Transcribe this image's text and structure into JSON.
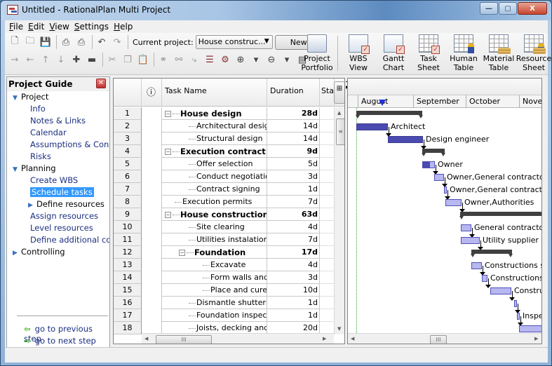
{
  "window": {
    "title": "Untitled - RationalPlan Multi Project",
    "controls": {
      "minimize": "—",
      "maximize": "▢",
      "close": "X"
    }
  },
  "menu": [
    {
      "label": "File",
      "mnemonic": "F",
      "rest": "ile"
    },
    {
      "label": "Edit",
      "mnemonic": "E",
      "rest": "dit"
    },
    {
      "label": "View",
      "mnemonic": "V",
      "rest": "iew"
    },
    {
      "label": "Settings",
      "mnemonic": "S",
      "rest": "ettings"
    },
    {
      "label": "Help",
      "mnemonic": "H",
      "rest": "elp"
    }
  ],
  "toolbar": {
    "row1_icons": [
      {
        "name": "new-file-icon",
        "glyph": "🗋"
      },
      {
        "name": "open-folder-icon",
        "glyph": "🗀"
      },
      {
        "name": "save-icon",
        "glyph": "💾"
      },
      {
        "name": "print-icon",
        "glyph": "⎙"
      },
      {
        "name": "print-preview-icon",
        "glyph": "⎙"
      },
      {
        "name": "undo-icon",
        "glyph": "↶"
      },
      {
        "name": "redo-icon",
        "glyph": "↷"
      }
    ],
    "current_project_label": "Current project:",
    "current_project_value": "House construc...",
    "new_button": "New",
    "row2_icons": [
      {
        "name": "indent-icon",
        "glyph": "→"
      },
      {
        "name": "outdent-icon",
        "glyph": "←"
      },
      {
        "name": "move-up-icon",
        "glyph": "↑"
      },
      {
        "name": "move-down-icon",
        "glyph": "↓"
      },
      {
        "name": "add-task-icon",
        "glyph": "✚"
      },
      {
        "name": "remove-task-icon",
        "glyph": "▬"
      },
      {
        "name": "cut-icon",
        "glyph": "✂"
      },
      {
        "name": "copy-icon",
        "glyph": "❐"
      },
      {
        "name": "paste-icon",
        "glyph": "📋"
      },
      {
        "name": "link-tasks-icon",
        "glyph": "⚭"
      },
      {
        "name": "unlink-tasks-icon",
        "glyph": "⚯"
      },
      {
        "name": "split-task-icon",
        "glyph": "⤷"
      },
      {
        "name": "gantt-bars-icon",
        "glyph": "☰"
      },
      {
        "name": "resource-assign-icon",
        "glyph": "⚙"
      },
      {
        "name": "zoom-in-icon",
        "glyph": "⊕"
      },
      {
        "name": "zoom-out-icon",
        "glyph": "⊖"
      },
      {
        "name": "notes-icon",
        "glyph": "▤"
      }
    ],
    "big_buttons": [
      {
        "name": "project-portfolio",
        "line1": "Project",
        "line2": "Portfolio"
      },
      {
        "name": "wbs-view",
        "line1": "WBS",
        "line2": "View"
      },
      {
        "name": "gantt-chart",
        "line1": "Gantt",
        "line2": "Chart"
      },
      {
        "name": "task-sheet",
        "line1": "Task",
        "line2": "Sheet"
      },
      {
        "name": "human-table",
        "line1": "Human",
        "line2": "Table"
      },
      {
        "name": "material-table",
        "line1": "Material",
        "line2": "Table"
      },
      {
        "name": "resource-sheet",
        "line1": "Resource",
        "line2": "Sheet"
      }
    ]
  },
  "guide": {
    "title": "Project Guide",
    "sections": [
      {
        "label": "Project",
        "expanded": true,
        "items": [
          "Info",
          "Notes & Links",
          "Calendar",
          "Assumptions & Constraints",
          "Risks"
        ]
      },
      {
        "label": "Planning",
        "expanded": true,
        "items": [
          "Create WBS",
          "Schedule tasks",
          "Define resources",
          "Assign resources",
          "Level resources",
          "Define additional costs"
        ]
      },
      {
        "label": "Controlling",
        "expanded": false,
        "items": []
      }
    ],
    "selected_item": "Schedule tasks",
    "prev_step": "go to previous step",
    "next_step": "go to next step"
  },
  "grid": {
    "columns": {
      "info": "ⓘ",
      "name": "Task Name",
      "duration": "Duration",
      "start": "Sta"
    },
    "rows": [
      {
        "id": "1",
        "name": "House design",
        "duration": "28d",
        "level": 0,
        "summary": true
      },
      {
        "id": "2",
        "name": "Architectural design",
        "duration": "14d",
        "level": 1,
        "summary": false
      },
      {
        "id": "3",
        "name": "Structural design",
        "duration": "14d",
        "level": 1,
        "summary": false
      },
      {
        "id": "4",
        "name": "Execution contract",
        "duration": "9d",
        "level": 0,
        "summary": true
      },
      {
        "id": "5",
        "name": "Offer selection",
        "duration": "5d",
        "level": 1,
        "summary": false
      },
      {
        "id": "6",
        "name": "Conduct negotiations",
        "duration": "3d",
        "level": 1,
        "summary": false
      },
      {
        "id": "7",
        "name": "Contract signing",
        "duration": "1d",
        "level": 1,
        "summary": false
      },
      {
        "id": "8",
        "name": "Execution permits",
        "duration": "7d",
        "level": 0,
        "summary": false
      },
      {
        "id": "9",
        "name": "House construction",
        "duration": "63d",
        "level": 0,
        "summary": true
      },
      {
        "id": "10",
        "name": "Site clearing",
        "duration": "4d",
        "level": 1,
        "summary": false
      },
      {
        "id": "11",
        "name": "Utilities instalation",
        "duration": "7d",
        "level": 1,
        "summary": false
      },
      {
        "id": "12",
        "name": "Foundation",
        "duration": "17d",
        "level": 1,
        "summary": true
      },
      {
        "id": "13",
        "name": "Excavate",
        "duration": "4d",
        "level": 2,
        "summary": false
      },
      {
        "id": "14",
        "name": "Form walls and ...",
        "duration": "3d",
        "level": 2,
        "summary": false
      },
      {
        "id": "15",
        "name": "Place and cure ...",
        "duration": "10d",
        "level": 2,
        "summary": false
      },
      {
        "id": "16",
        "name": "Dismantle shuttering",
        "duration": "1d",
        "level": 1,
        "summary": false
      },
      {
        "id": "17",
        "name": "Foundation inspection",
        "duration": "1d",
        "level": 1,
        "summary": false
      },
      {
        "id": "18",
        "name": "Joists, decking and ...",
        "duration": "20d",
        "level": 1,
        "summary": false
      }
    ]
  },
  "gantt": {
    "months": [
      "August",
      "September",
      "October",
      "November"
    ],
    "bar_colors": {
      "done": "#4a4ab0",
      "remaining": "#b8b8f0",
      "summary": "#404040"
    },
    "labels": [
      "Architect",
      "Design engineer",
      "Owner",
      "Owner,General contractor",
      "Owner,General contractor",
      "Owner,Authorities",
      "General contractor,c",
      "Utility supplier",
      "Constructions sul",
      "Constructions s",
      "Constru",
      "Inspe"
    ]
  }
}
